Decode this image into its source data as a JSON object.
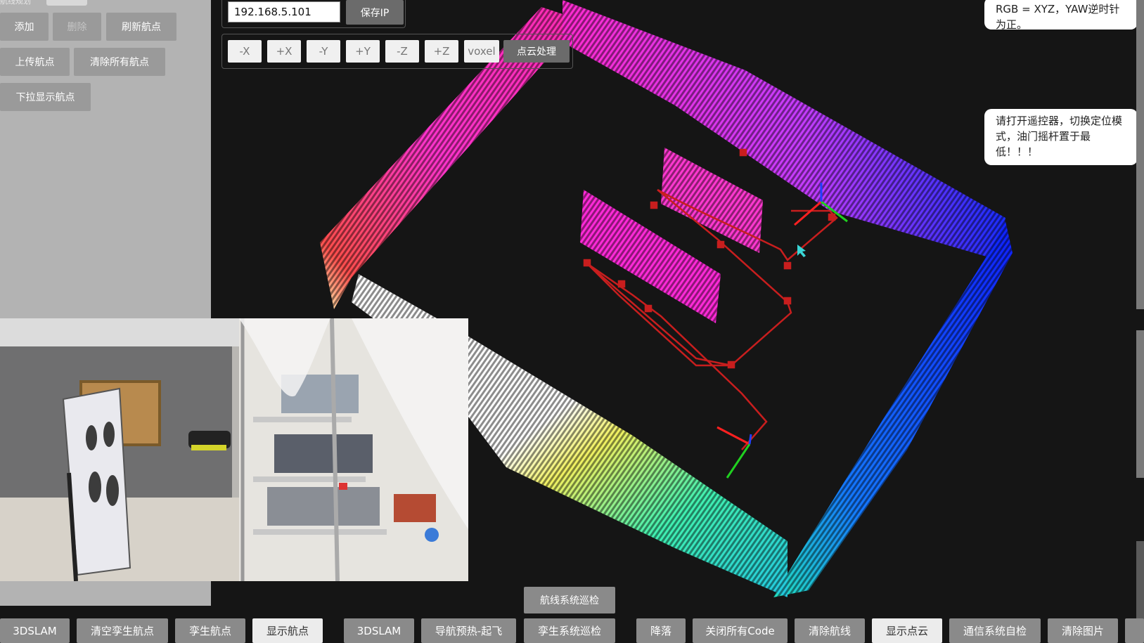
{
  "left_panel": {
    "header_label": "航线规划",
    "buttons": {
      "add": "添加",
      "delete": "删除",
      "refresh": "刷新航点",
      "upload": "上传航点",
      "clear_all": "清除所有航点",
      "dropdown_show": "下拉显示航点"
    }
  },
  "toolbar": {
    "ip_value": "192.168.5.101",
    "save_ip": "保存IP",
    "axis_buttons": [
      "-X",
      "+X",
      "-Y",
      "+Y",
      "-Z",
      "+Z",
      "voxel"
    ],
    "pointcloud_process": "点云处理"
  },
  "info_bubbles": {
    "rgb_note": "RGB = XYZ，YAW逆时针为正。",
    "rc_note": "请打开遥控器，切换定位模式，油门摇杆置于最低！！！"
  },
  "center_button": "航线系统巡检",
  "bottom_bar": [
    "3DSLAM",
    "清空孪生航点",
    "孪生航点",
    "显示航点",
    "3DSLAM",
    "导航预热-起飞",
    "孪生系统巡检",
    "降落",
    "关闭所有Code",
    "清除航线",
    "显示点云",
    "通信系统自检",
    "清除图片"
  ],
  "colors": {
    "background": "#151515",
    "left_panel": "#b3b3b3",
    "button": "#9a9a9a",
    "path": "#c81e1e"
  }
}
